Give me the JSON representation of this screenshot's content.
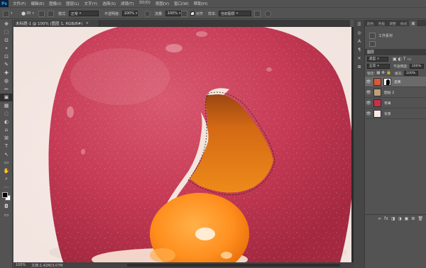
{
  "app": {
    "logo": "Ps"
  },
  "menu": [
    "文件(F)",
    "编辑(E)",
    "图像(I)",
    "图层(L)",
    "文字(Y)",
    "选择(S)",
    "滤镜(T)",
    "3D(D)",
    "视图(V)",
    "窗口(W)",
    "帮助(H)"
  ],
  "options": {
    "size": "30",
    "mode_label": "模式:",
    "mode_value": "正常",
    "opacity_label": "不透明度:",
    "opacity_value": "100%",
    "flow_label": "流量:",
    "flow_value": "100%",
    "aligned_label": "对齐",
    "aligned_checked": true,
    "sample_label": "样本:",
    "sample_value": "当前图层"
  },
  "document": {
    "tab_label": "未标题-1 @ 100% (图层 1, RGB/8#)",
    "tab_close": "×",
    "status_zoom": "100%",
    "status_doc": "文档:1.42M/3.07M"
  },
  "tools": [
    "✥",
    "⬚",
    "ʘ",
    "⌖",
    "⊡",
    "✎",
    "✚",
    "◍",
    "✏",
    "▣",
    "▦",
    "◌",
    "◐",
    "⌂",
    "⌘",
    "T",
    "↖",
    "▭",
    "✋",
    "⌕",
    "⋯"
  ],
  "side_icons": [
    "☰",
    "◎",
    "A",
    "¶",
    "✕",
    "⊞"
  ],
  "libraries_panel": {
    "tabs": [
      "颜色",
      "色板",
      "调整",
      "样式",
      "库"
    ],
    "active_tab": 4,
    "library_name": "工作素材"
  },
  "layers_panel": {
    "title": "图层",
    "kind_label": "类型",
    "blend_mode": "正常",
    "opacity_label": "不透明度:",
    "opacity_value": "100%",
    "lock_label": "锁定:",
    "fill_label": "填充:",
    "fill_value": "100%",
    "layers": [
      {
        "name": "蛋黄",
        "thumb": "#d75a3a",
        "mask": true,
        "selected": true
      },
      {
        "name": "图层 2",
        "thumb": "#bfa07a",
        "mask": false,
        "selected": false
      },
      {
        "name": "苹果",
        "thumb": "#c9304a",
        "mask": false,
        "selected": false
      },
      {
        "name": "背景",
        "thumb": "#f7e9e4",
        "mask": false,
        "selected": false
      }
    ],
    "footer_icons": [
      "∞",
      "fx",
      "◨",
      "◑",
      "▣",
      "⊞",
      "🗑"
    ]
  },
  "colors": {
    "apple": "#c73a56",
    "yolk": "#ff8a1c",
    "background": "#f4eeea"
  }
}
